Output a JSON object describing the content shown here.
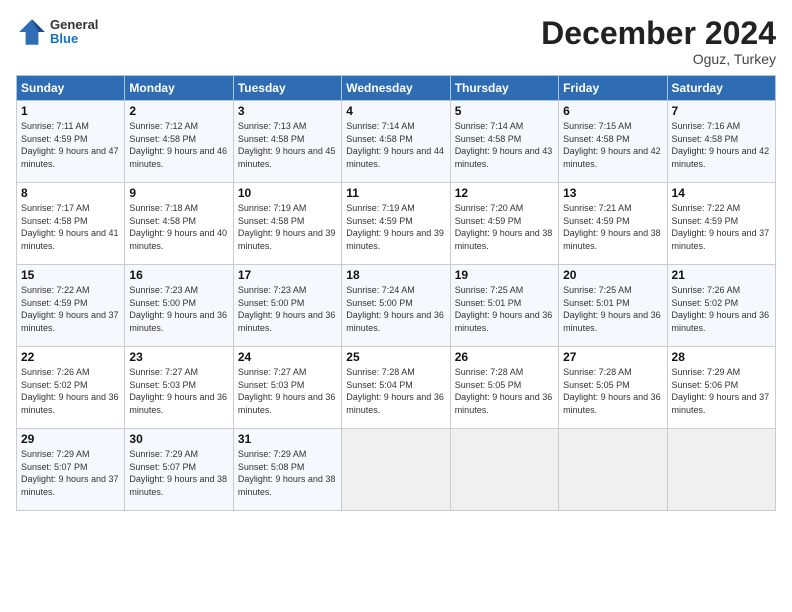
{
  "logo": {
    "general": "General",
    "blue": "Blue"
  },
  "title": "December 2024",
  "location": "Oguz, Turkey",
  "days_of_week": [
    "Sunday",
    "Monday",
    "Tuesday",
    "Wednesday",
    "Thursday",
    "Friday",
    "Saturday"
  ],
  "weeks": [
    [
      {
        "day": "1",
        "sunrise": "7:11 AM",
        "sunset": "4:59 PM",
        "daylight": "9 hours and 47 minutes."
      },
      {
        "day": "2",
        "sunrise": "7:12 AM",
        "sunset": "4:58 PM",
        "daylight": "9 hours and 46 minutes."
      },
      {
        "day": "3",
        "sunrise": "7:13 AM",
        "sunset": "4:58 PM",
        "daylight": "9 hours and 45 minutes."
      },
      {
        "day": "4",
        "sunrise": "7:14 AM",
        "sunset": "4:58 PM",
        "daylight": "9 hours and 44 minutes."
      },
      {
        "day": "5",
        "sunrise": "7:14 AM",
        "sunset": "4:58 PM",
        "daylight": "9 hours and 43 minutes."
      },
      {
        "day": "6",
        "sunrise": "7:15 AM",
        "sunset": "4:58 PM",
        "daylight": "9 hours and 42 minutes."
      },
      {
        "day": "7",
        "sunrise": "7:16 AM",
        "sunset": "4:58 PM",
        "daylight": "9 hours and 42 minutes."
      }
    ],
    [
      {
        "day": "8",
        "sunrise": "7:17 AM",
        "sunset": "4:58 PM",
        "daylight": "9 hours and 41 minutes."
      },
      {
        "day": "9",
        "sunrise": "7:18 AM",
        "sunset": "4:58 PM",
        "daylight": "9 hours and 40 minutes."
      },
      {
        "day": "10",
        "sunrise": "7:19 AM",
        "sunset": "4:58 PM",
        "daylight": "9 hours and 39 minutes."
      },
      {
        "day": "11",
        "sunrise": "7:19 AM",
        "sunset": "4:59 PM",
        "daylight": "9 hours and 39 minutes."
      },
      {
        "day": "12",
        "sunrise": "7:20 AM",
        "sunset": "4:59 PM",
        "daylight": "9 hours and 38 minutes."
      },
      {
        "day": "13",
        "sunrise": "7:21 AM",
        "sunset": "4:59 PM",
        "daylight": "9 hours and 38 minutes."
      },
      {
        "day": "14",
        "sunrise": "7:22 AM",
        "sunset": "4:59 PM",
        "daylight": "9 hours and 37 minutes."
      }
    ],
    [
      {
        "day": "15",
        "sunrise": "7:22 AM",
        "sunset": "4:59 PM",
        "daylight": "9 hours and 37 minutes."
      },
      {
        "day": "16",
        "sunrise": "7:23 AM",
        "sunset": "5:00 PM",
        "daylight": "9 hours and 36 minutes."
      },
      {
        "day": "17",
        "sunrise": "7:23 AM",
        "sunset": "5:00 PM",
        "daylight": "9 hours and 36 minutes."
      },
      {
        "day": "18",
        "sunrise": "7:24 AM",
        "sunset": "5:00 PM",
        "daylight": "9 hours and 36 minutes."
      },
      {
        "day": "19",
        "sunrise": "7:25 AM",
        "sunset": "5:01 PM",
        "daylight": "9 hours and 36 minutes."
      },
      {
        "day": "20",
        "sunrise": "7:25 AM",
        "sunset": "5:01 PM",
        "daylight": "9 hours and 36 minutes."
      },
      {
        "day": "21",
        "sunrise": "7:26 AM",
        "sunset": "5:02 PM",
        "daylight": "9 hours and 36 minutes."
      }
    ],
    [
      {
        "day": "22",
        "sunrise": "7:26 AM",
        "sunset": "5:02 PM",
        "daylight": "9 hours and 36 minutes."
      },
      {
        "day": "23",
        "sunrise": "7:27 AM",
        "sunset": "5:03 PM",
        "daylight": "9 hours and 36 minutes."
      },
      {
        "day": "24",
        "sunrise": "7:27 AM",
        "sunset": "5:03 PM",
        "daylight": "9 hours and 36 minutes."
      },
      {
        "day": "25",
        "sunrise": "7:28 AM",
        "sunset": "5:04 PM",
        "daylight": "9 hours and 36 minutes."
      },
      {
        "day": "26",
        "sunrise": "7:28 AM",
        "sunset": "5:05 PM",
        "daylight": "9 hours and 36 minutes."
      },
      {
        "day": "27",
        "sunrise": "7:28 AM",
        "sunset": "5:05 PM",
        "daylight": "9 hours and 36 minutes."
      },
      {
        "day": "28",
        "sunrise": "7:29 AM",
        "sunset": "5:06 PM",
        "daylight": "9 hours and 37 minutes."
      }
    ],
    [
      {
        "day": "29",
        "sunrise": "7:29 AM",
        "sunset": "5:07 PM",
        "daylight": "9 hours and 37 minutes."
      },
      {
        "day": "30",
        "sunrise": "7:29 AM",
        "sunset": "5:07 PM",
        "daylight": "9 hours and 38 minutes."
      },
      {
        "day": "31",
        "sunrise": "7:29 AM",
        "sunset": "5:08 PM",
        "daylight": "9 hours and 38 minutes."
      },
      null,
      null,
      null,
      null
    ]
  ]
}
